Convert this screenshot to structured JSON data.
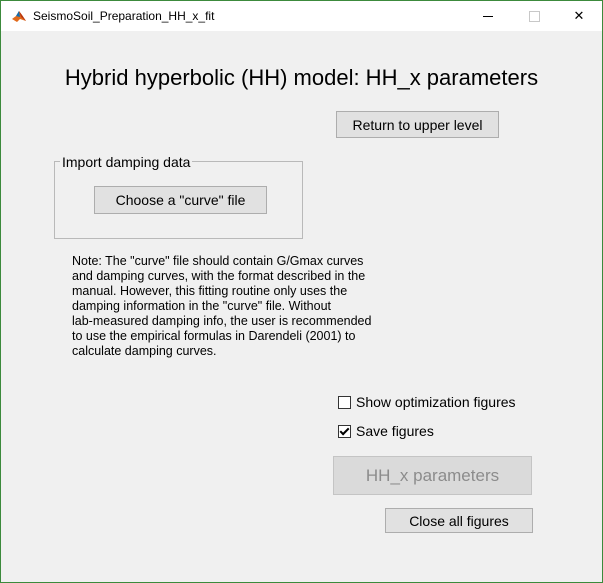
{
  "window": {
    "title": "SeismoSoil_Preparation_HH_x_fit"
  },
  "heading": "Hybrid hyperbolic (HH) model: HH_x parameters",
  "buttons": {
    "return_label": "Return to upper level",
    "choose_label": "Choose a \"curve\" file",
    "hhx_label": "HH_x parameters",
    "close_label": "Close all figures"
  },
  "import_group": {
    "legend": "Import damping data"
  },
  "note_lines": [
    "Note: The \"curve\" file should contain G/Gmax curves",
    "and damping curves, with the format described in the",
    "manual. However, this fitting routine only uses the",
    "damping information in the \"curve\" file. Without",
    "lab-measured damping info, the user is recommended",
    "to use the empirical formulas in Darendeli (2001) to",
    "calculate damping curves."
  ],
  "checkboxes": {
    "show_optimization": {
      "label": "Show optimization figures",
      "checked": false
    },
    "save_figures": {
      "label": "Save figures",
      "checked": true
    }
  },
  "icons": {
    "app": "matlab-icon",
    "minimize": "minimize-icon",
    "maximize": "maximize-icon",
    "close": "close-icon"
  },
  "colors": {
    "window_border": "#3c8a3c",
    "background": "#f0f0f0",
    "button_face": "#e1e1e1",
    "disabled_text": "#8c8c8c"
  }
}
